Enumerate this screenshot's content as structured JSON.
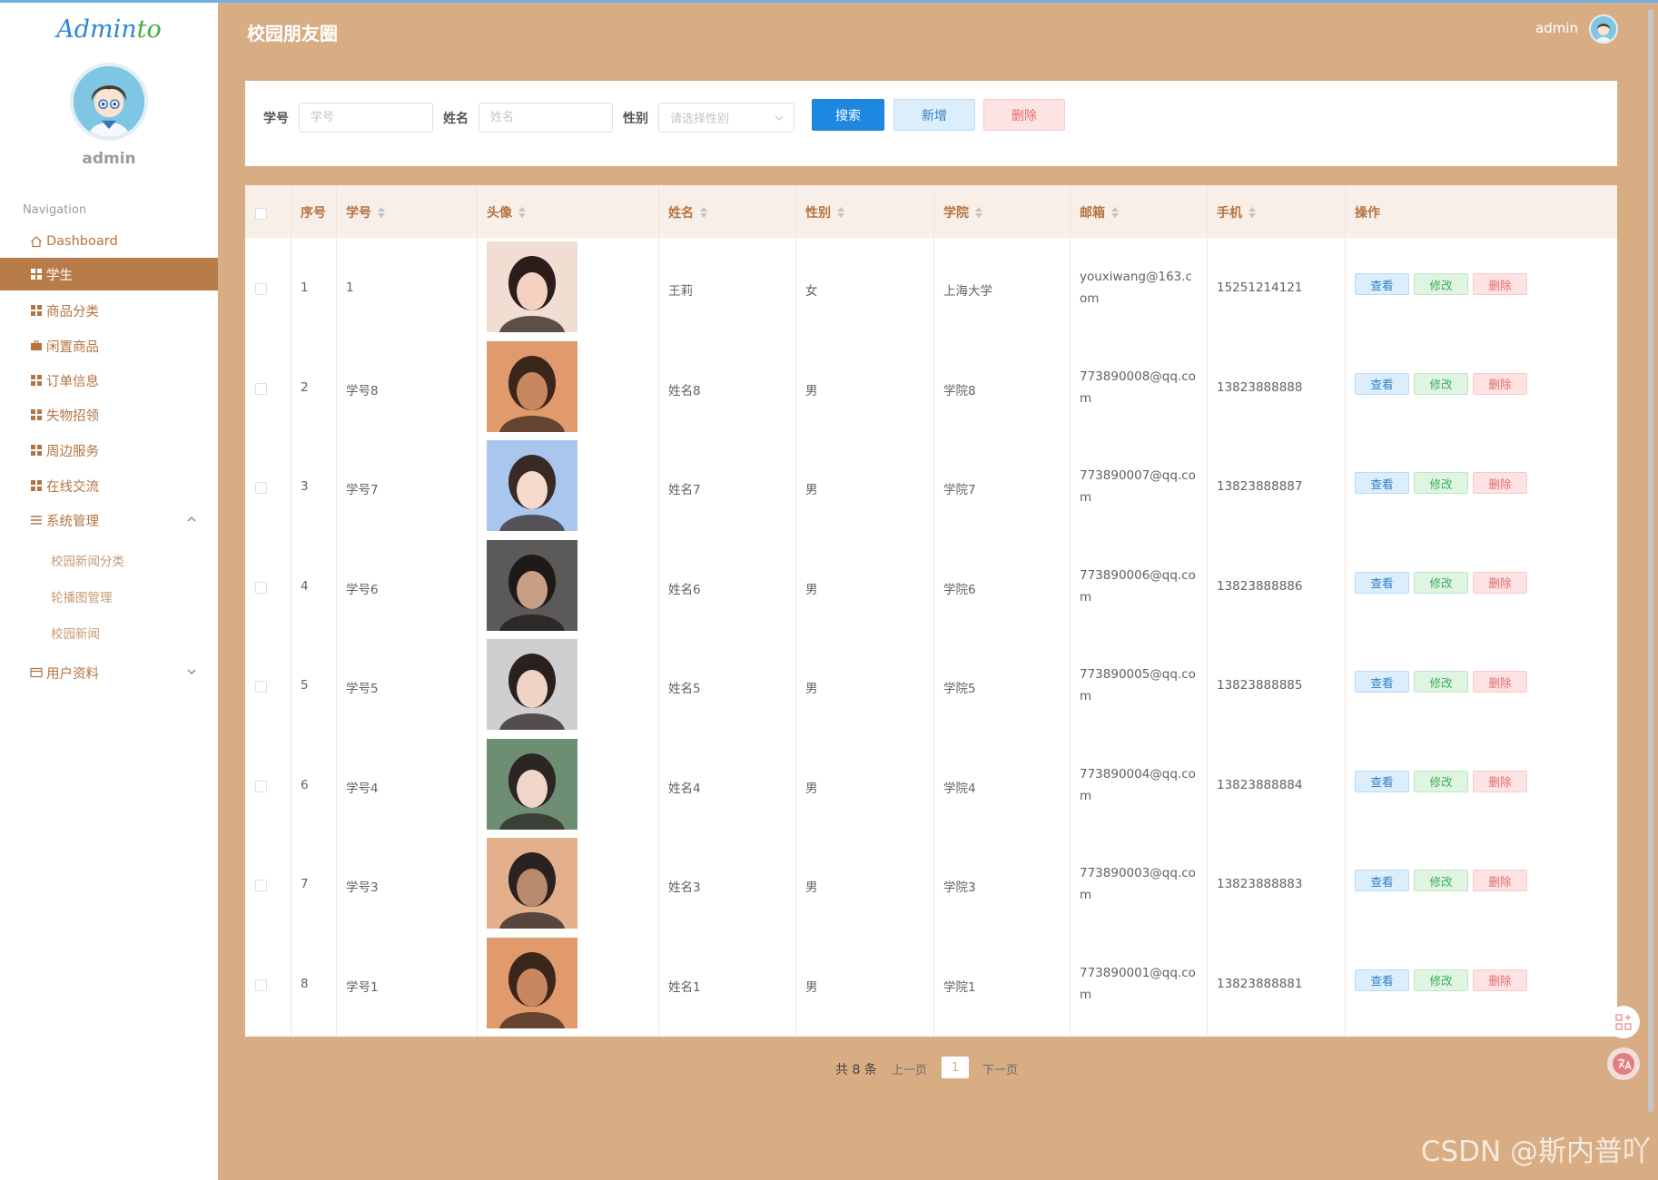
{
  "brand": {
    "logo_part1": "Admin",
    "logo_part2": "to"
  },
  "sidebar": {
    "username": "admin",
    "nav_heading": "Navigation",
    "items": [
      {
        "label": "Dashboard",
        "icon": "home-icon"
      },
      {
        "label": "学生",
        "icon": "grid-icon",
        "active": true
      },
      {
        "label": "商品分类",
        "icon": "grid-icon"
      },
      {
        "label": "闲置商品",
        "icon": "briefcase-icon"
      },
      {
        "label": "订单信息",
        "icon": "grid-icon"
      },
      {
        "label": "失物招领",
        "icon": "grid-icon"
      },
      {
        "label": "周边服务",
        "icon": "grid-icon"
      },
      {
        "label": "在线交流",
        "icon": "grid-icon"
      },
      {
        "label": "系统管理",
        "icon": "list-icon",
        "expanded": true
      },
      {
        "label": "用户资料",
        "icon": "card-icon",
        "expanded": false
      }
    ],
    "sub_items": [
      "校园新闻分类",
      "轮播图管理",
      "校园新闻"
    ]
  },
  "header": {
    "title": "校园朋友圈",
    "user": "admin"
  },
  "search": {
    "student_id_label": "学号",
    "student_id_placeholder": "学号",
    "name_label": "姓名",
    "name_placeholder": "姓名",
    "gender_label": "性别",
    "gender_placeholder": "请选择性别",
    "search_button": "搜索",
    "add_button": "新增",
    "delete_button": "删除"
  },
  "table": {
    "columns": [
      "序号",
      "学号",
      "头像",
      "姓名",
      "性别",
      "学院",
      "邮箱",
      "手机",
      "操作"
    ],
    "actions": {
      "view": "查看",
      "edit": "修改",
      "delete": "删除"
    },
    "rows": [
      {
        "index": "1",
        "student_id": "1",
        "name": "王莉",
        "gender": "女",
        "college": "上海大学",
        "email": "youxiwang@163.com",
        "phone": "15251214121"
      },
      {
        "index": "2",
        "student_id": "学号8",
        "name": "姓名8",
        "gender": "男",
        "college": "学院8",
        "email": "773890008@qq.com",
        "phone": "13823888888"
      },
      {
        "index": "3",
        "student_id": "学号7",
        "name": "姓名7",
        "gender": "男",
        "college": "学院7",
        "email": "773890007@qq.com",
        "phone": "13823888887"
      },
      {
        "index": "4",
        "student_id": "学号6",
        "name": "姓名6",
        "gender": "男",
        "college": "学院6",
        "email": "773890006@qq.com",
        "phone": "13823888886"
      },
      {
        "index": "5",
        "student_id": "学号5",
        "name": "姓名5",
        "gender": "男",
        "college": "学院5",
        "email": "773890005@qq.com",
        "phone": "13823888885"
      },
      {
        "index": "6",
        "student_id": "学号4",
        "name": "姓名4",
        "gender": "男",
        "college": "学院4",
        "email": "773890004@qq.com",
        "phone": "13823888884"
      },
      {
        "index": "7",
        "student_id": "学号3",
        "name": "姓名3",
        "gender": "男",
        "college": "学院3",
        "email": "773890003@qq.com",
        "phone": "13823888883"
      },
      {
        "index": "8",
        "student_id": "学号1",
        "name": "姓名1",
        "gender": "男",
        "college": "学院1",
        "email": "773890001@qq.com",
        "phone": "13823888881"
      }
    ]
  },
  "pagination": {
    "total": "共 8 条",
    "prev": "上一页",
    "current": "1",
    "next": "下一页"
  },
  "watermark": "CSDN @斯内普吖",
  "colors": {
    "page_bg": "#d8ad84",
    "accent": "#b87c49",
    "primary": "#1c88e0",
    "danger": "#e86a6a",
    "success": "#3dae5a"
  }
}
